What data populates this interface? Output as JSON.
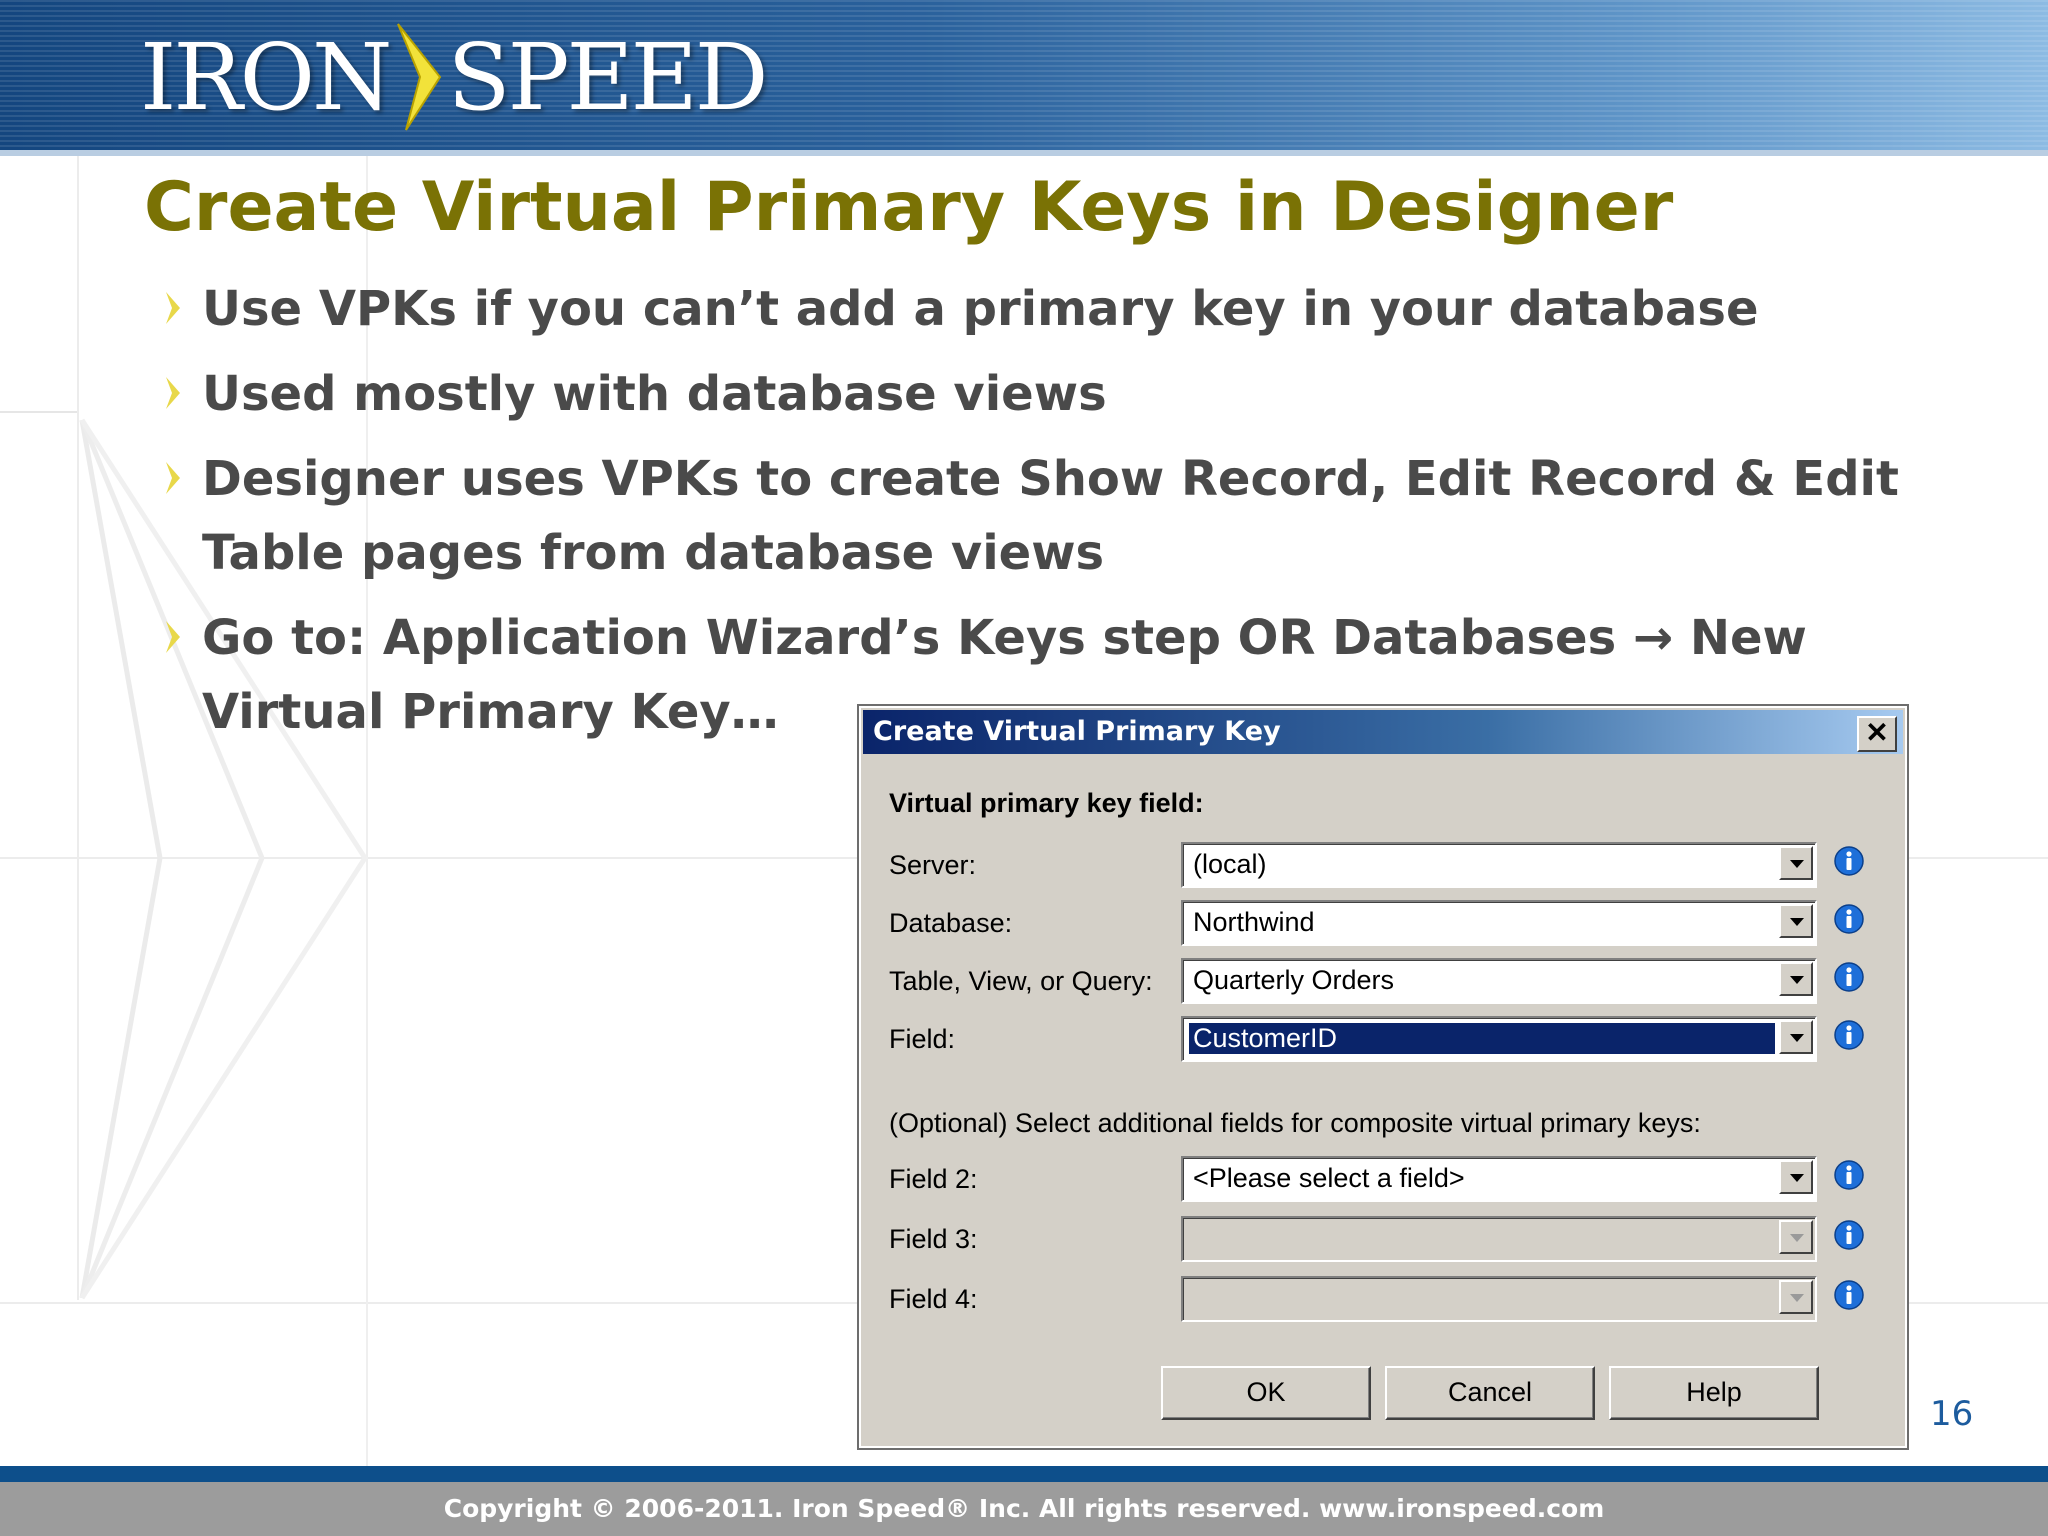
{
  "brand": {
    "logo_left": "IRON",
    "logo_right": "SPEED"
  },
  "slide": {
    "title": "Create Virtual Primary Keys in Designer",
    "bullets": [
      {
        "line1": "Use VPKs if you can’t add a primary key in your database",
        "line2": ""
      },
      {
        "line1": "Used mostly with database views",
        "line2": ""
      },
      {
        "line1": "Designer uses VPKs to create Show Record, Edit Record & Edit",
        "line2": "Table pages from database views"
      },
      {
        "line1": "Go to: Application Wizard’s Keys step OR Databases → New",
        "line2": "Virtual Primary Key…"
      }
    ],
    "page_number": "16"
  },
  "dialog": {
    "title": "Create Virtual Primary Key",
    "close_glyph": "✕",
    "section_primary": "Virtual primary key field:",
    "fields": [
      {
        "label": "Server:",
        "value": "(local)",
        "selected": false,
        "disabled": false
      },
      {
        "label": "Database:",
        "value": "Northwind",
        "selected": false,
        "disabled": false
      },
      {
        "label": "Table, View, or Query:",
        "value": "Quarterly Orders",
        "selected": false,
        "disabled": false
      },
      {
        "label": "Field:",
        "value": "CustomerID",
        "selected": true,
        "disabled": false
      }
    ],
    "section_optional": "(Optional) Select additional fields for composite virtual primary keys:",
    "optional_fields": [
      {
        "label": "Field 2:",
        "value": "<Please select a field>",
        "disabled": false
      },
      {
        "label": "Field 3:",
        "value": "",
        "disabled": true
      },
      {
        "label": "Field 4:",
        "value": "",
        "disabled": true
      }
    ],
    "buttons": {
      "ok": "OK",
      "cancel": "Cancel",
      "help": "Help"
    },
    "icons": {
      "info": "info-icon",
      "dropdown": "chevron-down-icon"
    }
  },
  "footer": {
    "copyright": "Copyright © 2006-2011. Iron Speed® Inc. All rights reserved.  www.ironspeed.com"
  },
  "colors": {
    "title": "#7a7205",
    "header_blue": "#14467f",
    "dialog_bg": "#d4d0c8",
    "selection": "#0a246a",
    "info_icon": "#1e6fd9"
  }
}
